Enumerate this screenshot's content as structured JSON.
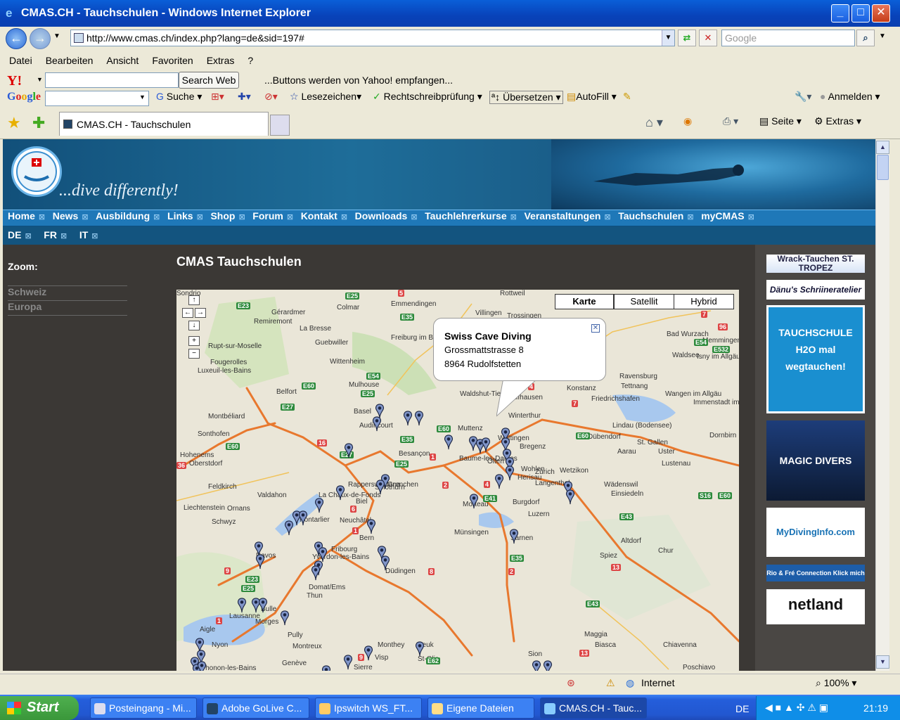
{
  "window": {
    "title": "CMAS.CH - Tauchschulen - Windows Internet Explorer",
    "min": "_",
    "max": "□",
    "close": "✕"
  },
  "address": {
    "url": "http://www.cmas.ch/index.php?lang=de&sid=197#",
    "search_placeholder": "Google"
  },
  "menu": [
    "Datei",
    "Bearbeiten",
    "Ansicht",
    "Favoriten",
    "Extras",
    "?"
  ],
  "yahoo": {
    "logo": "Y!",
    "button": "Search Web",
    "message": "...Buttons werden von Yahoo! empfangen..."
  },
  "google_toolbar": {
    "logo": "Google",
    "search": "Suche",
    "bookmarks": "Lesezeichen",
    "spell": "Rechtschreibprüfung",
    "translate": "Übersetzen",
    "autofill": "AutoFill",
    "signin": "Anmelden"
  },
  "tabs": [
    {
      "label": "CMAS.CH - Tauchschulen"
    }
  ],
  "commandbar": {
    "page": "Seite",
    "extras": "Extras"
  },
  "site": {
    "tagline": "...dive differently!",
    "nav": [
      "Home",
      "News",
      "Ausbildung",
      "Links",
      "Shop",
      "Forum",
      "Kontakt",
      "Downloads",
      "Tauchlehrerkurse",
      "Veranstaltungen",
      "Tauchschulen",
      "myCMAS"
    ],
    "langs": [
      "DE",
      "FR",
      "IT"
    ],
    "zoom_label": "Zoom:",
    "zoom_links": [
      "Schweiz",
      "Europa"
    ],
    "heading": "CMAS Tauchschulen",
    "ads": [
      "Wrack-Tauchen ST. TROPEZ",
      "Dänu's Schriineratelier",
      "TAUCHSCHULE H2O mal wegtauchen!",
      "MAGIC DIVERS",
      "MyDivingInfo.com",
      "Rio & Fré Connection Klick mich",
      "netland"
    ]
  },
  "map": {
    "types": [
      "Karte",
      "Satellit",
      "Hybrid"
    ],
    "popup": {
      "title": "Swiss Cave Diving",
      "street": "Grossmattstrasse 8",
      "city": "8964 Rudolfstetten"
    },
    "cities": [
      "Rottweil",
      "Emmendingen",
      "Colmar",
      "Villingen",
      "Gérardmer",
      "Trossingen",
      "Konstanz",
      "Freiburg im Breisgau",
      "Remiremont",
      "La Bresse",
      "Guebwiller",
      "Bad Wurzach",
      "Memmingen",
      "Rupt-sur-Moselle",
      "Wittenheim",
      "Waldsee",
      "Isny im Allgäu",
      "Fougerolles",
      "Mulhouse",
      "Ravensburg",
      "Tettnang",
      "Wangen im Allgäu",
      "Luxeuil-les-Bains",
      "Belfort",
      "Waldshut-Tiengen",
      "Immenstadt im Allgäu",
      "Friedrichshafen",
      "Montbéliard",
      "Basel",
      "Schaffhausen",
      "Winterthur",
      "Lindau (Bodensee)",
      "Sonthofen",
      "Audincourt",
      "Muttenz",
      "Wettingen",
      "Dübendorf",
      "St. Gallen",
      "Bregenz",
      "Aarau",
      "Uster",
      "Lustenau",
      "Dornbirn",
      "Hohenems",
      "Oberstdorf",
      "Besançon",
      "Baume-les-Dames",
      "Olten",
      "Wohlen",
      "Zürich",
      "Wetzikon",
      "Herisau",
      "Rapperswil-Jona",
      "Solothurn",
      "Grenchen",
      "Langenthal",
      "Wädenswil",
      "Feldkirch",
      "Valdahon",
      "La Chaux-de-Fonds",
      "Biel",
      "Burgdorf",
      "Einsiedeln",
      "Liechtenstein",
      "Ornans",
      "Morteau",
      "Luzern",
      "Schwyz",
      "Pontarlier",
      "Neuchâtel",
      "Bern",
      "Münsingen",
      "Sarnen",
      "Altdorf",
      "Chur",
      "Davos",
      "Yverdon-les-Bains",
      "Fribourg",
      "Düdingen",
      "Spiez",
      "Domat/Ems",
      "Thun",
      "Bulle",
      "Lausanne",
      "Morges",
      "Pully",
      "Montreux",
      "Aigle",
      "Nyon",
      "Thonon-les-Bains",
      "Genève",
      "Monthey",
      "Leuk",
      "St-Glis",
      "Visp",
      "Sierre",
      "Sion",
      "Maggia",
      "Biasca",
      "Chiavenna",
      "Poschiavo",
      "Sondrio"
    ]
  },
  "status": {
    "zone": "Internet",
    "zoom": "100%"
  },
  "taskbar": {
    "start": "Start",
    "tasks": [
      "Posteingang - Mi...",
      "Adobe GoLive C...",
      "Ipswitch WS_FT...",
      "Eigene Dateien",
      "CMAS.CH - Tauc..."
    ],
    "lang": "DE",
    "time": "21:19"
  },
  "colors": {
    "xp_blue": "#0842b9",
    "nav_blue": "#1f78b8",
    "page_bg": "#3b3835",
    "motorway": "#e8782e"
  }
}
